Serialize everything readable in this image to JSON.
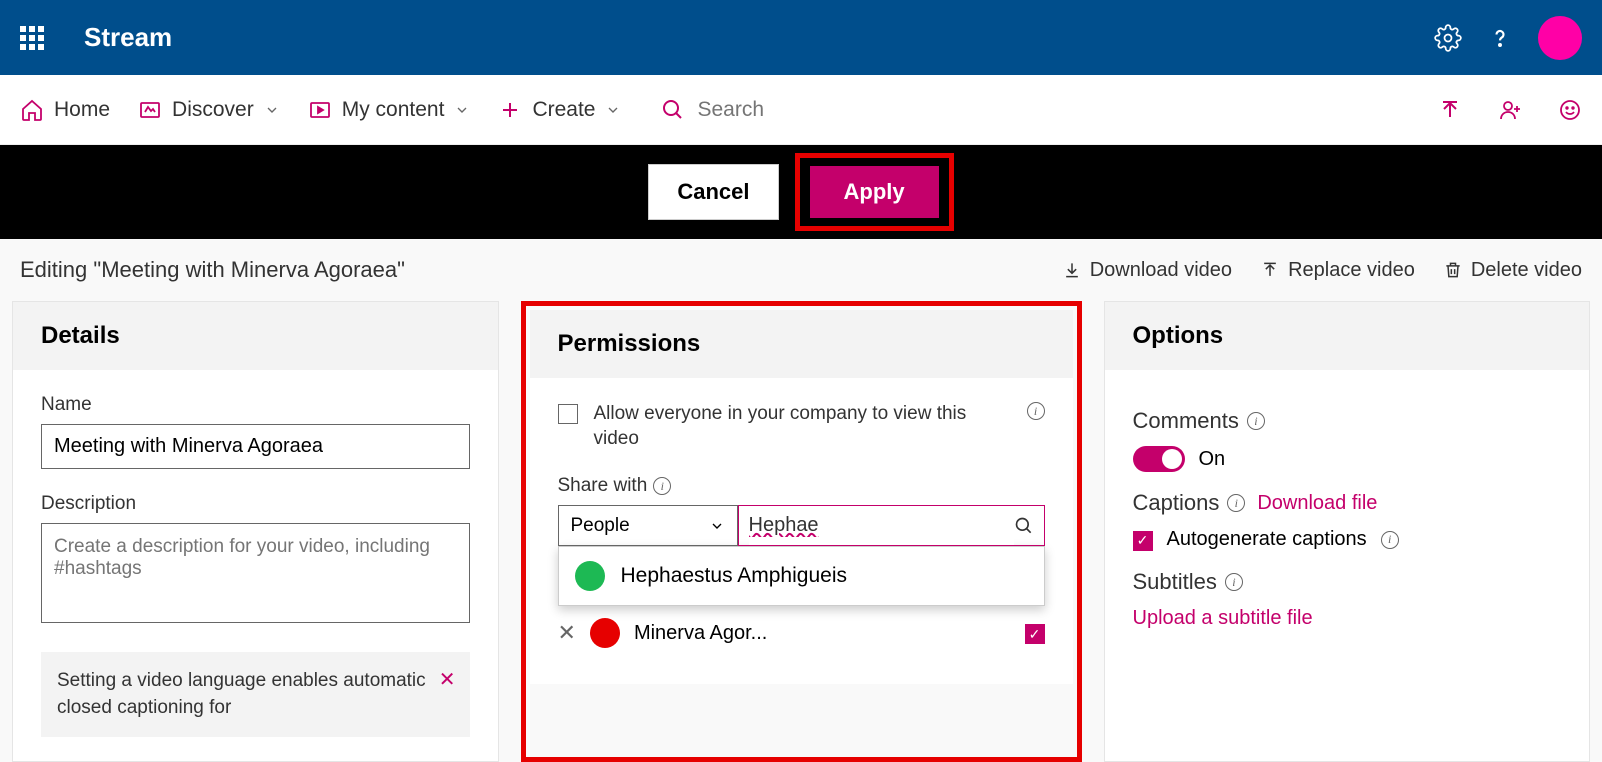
{
  "header": {
    "app_name": "Stream"
  },
  "nav": {
    "home": "Home",
    "discover": "Discover",
    "my_content": "My content",
    "create": "Create",
    "search_placeholder": "Search"
  },
  "action_bar": {
    "cancel": "Cancel",
    "apply": "Apply"
  },
  "title_bar": {
    "editing_text": "Editing \"Meeting with Minerva Agoraea\"",
    "download": "Download video",
    "replace": "Replace video",
    "delete": "Delete video"
  },
  "details": {
    "panel_title": "Details",
    "name_label": "Name",
    "name_value": "Meeting with Minerva Agoraea",
    "desc_label": "Description",
    "desc_placeholder": "Create a description for your video, including #hashtags",
    "info_text": "Setting a video language enables automatic closed captioning for"
  },
  "permissions": {
    "panel_title": "Permissions",
    "allow_everyone": "Allow everyone in your company to view this video",
    "share_label": "Share with",
    "scope": "People",
    "search_value": "Hephae",
    "suggestion": {
      "name": "Hephaestus Amphigueis",
      "color": "#1db954"
    },
    "shared": [
      {
        "name": "Minerva Agor...",
        "color": "#e60000",
        "checked": true
      }
    ]
  },
  "options": {
    "panel_title": "Options",
    "comments_label": "Comments",
    "comments_state": "On",
    "captions_label": "Captions",
    "captions_download": "Download file",
    "autogen": "Autogenerate captions",
    "subtitles_label": "Subtitles",
    "upload_subtitle": "Upload a subtitle file"
  }
}
